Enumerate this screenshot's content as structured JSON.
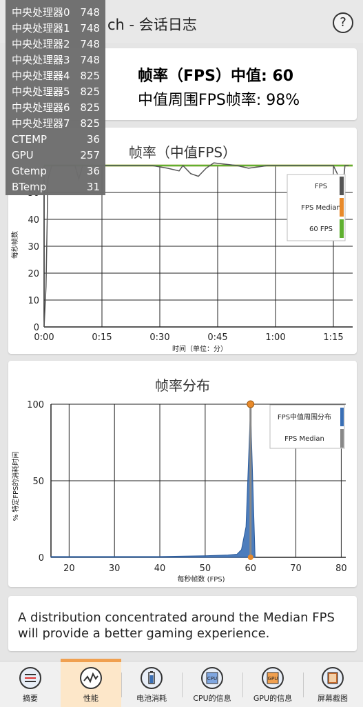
{
  "header": {
    "title": "ch - 会话日志",
    "help_label": "?"
  },
  "summary": {
    "line1": "帧率（FPS）中值: 60",
    "line2": "中值周围FPS帧率: 98%"
  },
  "overlay": {
    "rows": [
      {
        "label": "中央处理器0",
        "value": "748"
      },
      {
        "label": "中央处理器1",
        "value": "748"
      },
      {
        "label": "中央处理器2",
        "value": "748"
      },
      {
        "label": "中央处理器3",
        "value": "748"
      },
      {
        "label": "中央处理器4",
        "value": "825"
      },
      {
        "label": "中央处理器5",
        "value": "825"
      },
      {
        "label": "中央处理器6",
        "value": "825"
      },
      {
        "label": "中央处理器7",
        "value": "825"
      },
      {
        "label": "CTEMP",
        "value": "36"
      },
      {
        "label": "GPU",
        "value": "257"
      },
      {
        "label": "Gtemp",
        "value": "36"
      },
      {
        "label": "BTemp",
        "value": "31"
      }
    ]
  },
  "info": {
    "text": "A distribution concentrated around the Median FPS will provide a better gaming experience."
  },
  "tabs": [
    {
      "label": "摘要",
      "icon": "summary-icon"
    },
    {
      "label": "性能",
      "icon": "performance-icon",
      "active": true
    },
    {
      "label": "电池消耗",
      "icon": "battery-icon"
    },
    {
      "label": "CPU的信息",
      "icon": "cpu-icon"
    },
    {
      "label": "GPU的信息",
      "icon": "gpu-icon"
    },
    {
      "label": "屏幕截图",
      "icon": "screenshot-icon"
    }
  ],
  "chart_data": [
    {
      "type": "line",
      "title": "帧率（中值FPS）",
      "xlabel": "时间（单位：分）",
      "ylabel": "每秒帧数",
      "x_tick_labels": [
        "0:00",
        "0:15",
        "0:30",
        "0:45",
        "1:00",
        "1:15"
      ],
      "y_tick_labels": [
        "0",
        "10",
        "20",
        "30",
        "40",
        "50"
      ],
      "xlim_seconds": [
        0,
        80
      ],
      "ylim": [
        0,
        60
      ],
      "grid": true,
      "legend": "top-right",
      "legend_entries": [
        "FPS",
        "FPS Median",
        "60 FPS"
      ],
      "colors": {
        "FPS": "#555555",
        "FPS Median": "#e88a2b",
        "60 FPS": "#5fb030"
      },
      "series": [
        {
          "name": "FPS",
          "x": [
            0,
            0.5,
            1,
            2,
            4,
            8,
            9,
            10,
            14,
            20,
            28,
            32,
            35,
            36,
            38,
            40,
            42,
            44,
            50,
            53,
            58,
            63,
            68,
            72,
            75,
            76,
            77,
            78,
            79
          ],
          "y": [
            0,
            15,
            55,
            60,
            60,
            60,
            55,
            60,
            60,
            60,
            60,
            59,
            58,
            60,
            57,
            56,
            59,
            61,
            60,
            59,
            60,
            60,
            60,
            60,
            60,
            57,
            45,
            60,
            60
          ]
        },
        {
          "name": "FPS Median",
          "x": [
            0,
            80
          ],
          "y": [
            60,
            60
          ]
        },
        {
          "name": "60 FPS",
          "x": [
            0,
            80
          ],
          "y": [
            60,
            60
          ]
        }
      ]
    },
    {
      "type": "area",
      "title": "帧率分布",
      "xlabel": "每秒帧数 (FPS)",
      "ylabel": "% 特定FPS的消耗时间",
      "x_tick_labels": [
        "20",
        "30",
        "40",
        "50",
        "60",
        "70",
        "80"
      ],
      "y_tick_labels": [
        "0",
        "50",
        "100"
      ],
      "xlim": [
        16,
        81
      ],
      "ylim": [
        0,
        100
      ],
      "grid": true,
      "legend": "top-right",
      "legend_entries": [
        "FPS中值周围分布",
        "FPS Median"
      ],
      "colors": {
        "FPS中值周围分布": "#3a6fb5",
        "FPS Median": "#888888",
        "marker": "#e88a2b"
      },
      "series": [
        {
          "name": "FPS中值周围分布",
          "x": [
            16,
            30,
            40,
            50,
            55,
            57,
            58,
            59,
            60,
            61
          ],
          "y": [
            0.5,
            0.5,
            0.5,
            1,
            1.5,
            2,
            5,
            20,
            98,
            0
          ]
        },
        {
          "name": "FPS Median",
          "x": [
            60,
            60
          ],
          "y": [
            0,
            100
          ]
        }
      ]
    }
  ]
}
